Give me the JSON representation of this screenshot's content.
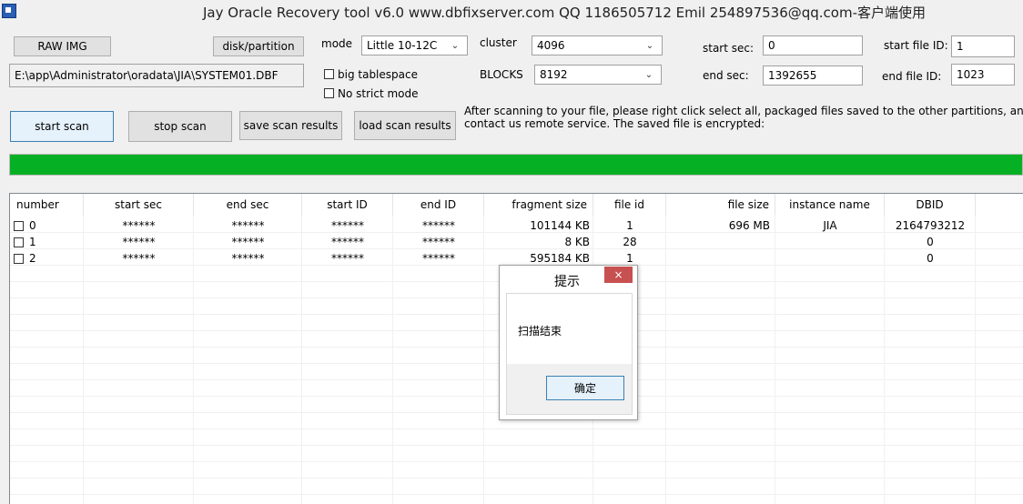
{
  "title": "Jay Oracle Recovery tool v6.0 www.dbfixserver.com QQ 1186505712 Emil 254897536@qq.com-客户端使用",
  "buttons": {
    "raw_img": "RAW IMG",
    "disk_partition": "disk/partition",
    "start_scan": "start scan",
    "stop_scan": "stop scan",
    "save_scan_results": "save scan results",
    "load_scan_results": "load scan results"
  },
  "file_path": "E:\\app\\Administrator\\oradata\\JIA\\SYSTEM01.DBF",
  "mode": {
    "label": "mode",
    "value": "Little 10-12C"
  },
  "cluster": {
    "label": "cluster",
    "value": "4096"
  },
  "blocks": {
    "label": "BLOCKS",
    "value": "8192"
  },
  "checkboxes": {
    "big_tablespace": "big tablespace",
    "no_strict_mode": "No strict mode"
  },
  "start_sec": {
    "label": "start sec:",
    "value": "0"
  },
  "end_sec": {
    "label": "end sec:",
    "value": "1392655"
  },
  "start_file_id": {
    "label": "start file ID:",
    "value": "1"
  },
  "end_file_id": {
    "label": "end file ID:",
    "value": "1023"
  },
  "info_line1": "After scanning to your file, please right click select all, packaged files saved to the other partitions, and then con",
  "info_line2": "contact us remote service. The saved file is encrypted:",
  "progress": {
    "percent": 100,
    "color": "#06b025"
  },
  "table": {
    "headers": [
      "number",
      "start sec",
      "end sec",
      "start ID",
      "end ID",
      "fragment size",
      "file id",
      "file size",
      "instance name",
      "DBID"
    ],
    "rows": [
      [
        "0",
        "******",
        "******",
        "******",
        "******",
        "101144 KB",
        "1",
        "696 MB",
        "JIA",
        "2164793212"
      ],
      [
        "1",
        "******",
        "******",
        "******",
        "******",
        "8 KB",
        "28",
        "",
        "",
        "0"
      ],
      [
        "2",
        "******",
        "******",
        "******",
        "******",
        "595184 KB",
        "1",
        "",
        "",
        "0"
      ]
    ]
  },
  "dialog": {
    "title": "提示",
    "close": "×",
    "message": "扫描结束",
    "ok": "确定"
  }
}
